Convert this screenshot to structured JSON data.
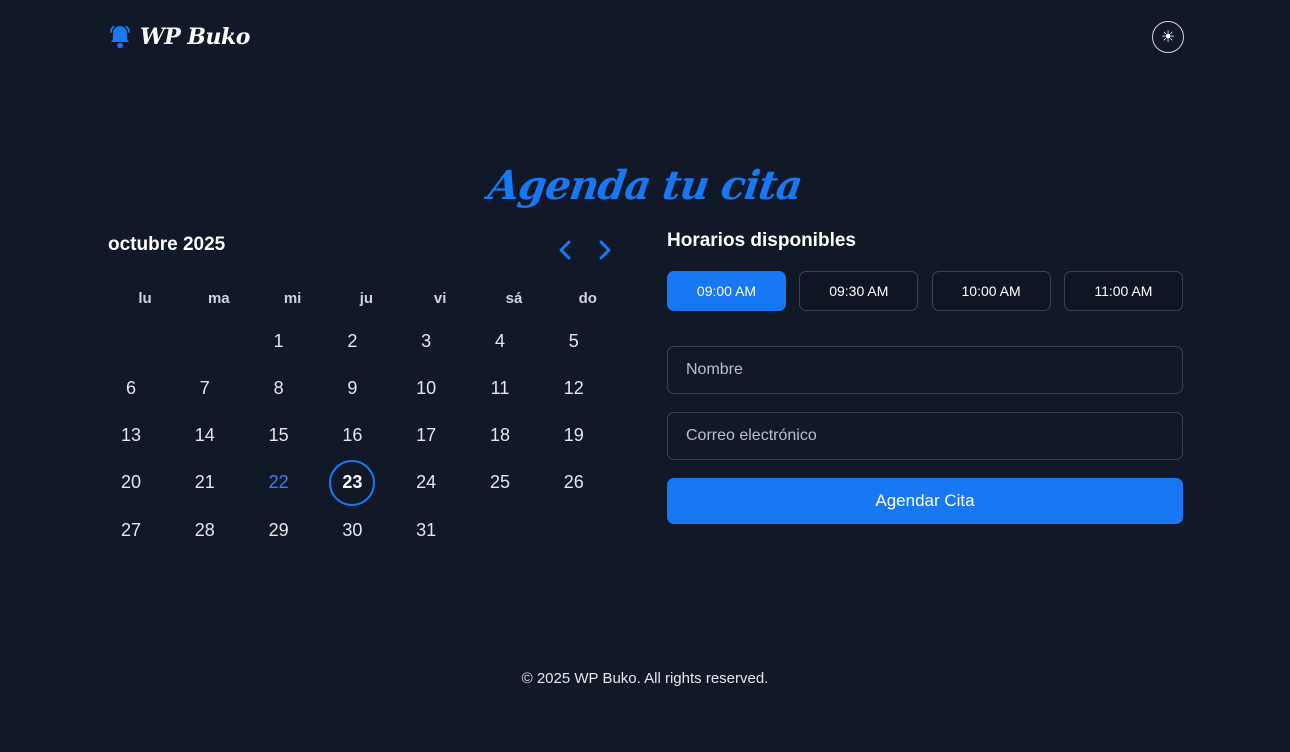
{
  "header": {
    "brand_name": "WP Buko",
    "theme_toggle_icon": "☀"
  },
  "title": "Agenda tu cita",
  "calendar": {
    "month_label": "octubre 2025",
    "weekdays": [
      "lu",
      "ma",
      "mi",
      "ju",
      "vi",
      "sá",
      "do"
    ],
    "first_weekday_index": 2,
    "days_in_month": 31,
    "today": 22,
    "selected": 23
  },
  "booking": {
    "slots_title": "Horarios disponibles",
    "slots": [
      "09:00 AM",
      "09:30 AM",
      "10:00 AM",
      "11:00 AM"
    ],
    "active_slot": "09:00 AM",
    "name_placeholder": "Nombre",
    "email_placeholder": "Correo electrónico",
    "submit_label": "Agendar Cita"
  },
  "footer": {
    "copyright": "© 2025 WP Buko. All rights reserved."
  },
  "colors": {
    "background": "#111827",
    "accent": "#1877f2"
  }
}
